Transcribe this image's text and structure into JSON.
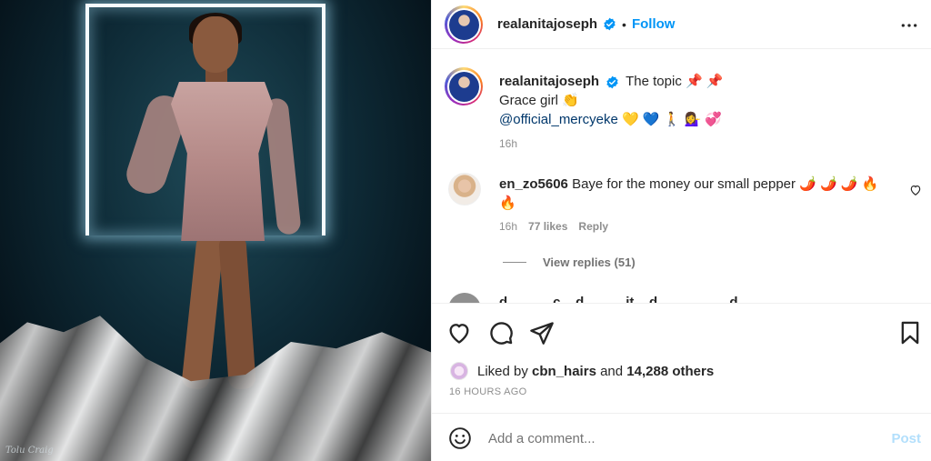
{
  "post": {
    "author": "realanitajoseph",
    "follow_label": "Follow",
    "separator": "•",
    "more_icon": "more-horizontal-icon",
    "photo_signature": "Tolu Craig"
  },
  "caption": {
    "username": "realanitajoseph",
    "line1": "The topic 📌 📌",
    "line2": "Grace girl 👏",
    "mention": "@official_mercyeke",
    "mention_emojis": "💛 💙 🚶 💁‍♀️ 💞",
    "time": "16h"
  },
  "comments": [
    {
      "username": "en_zo5606",
      "text": "Baye for the money our small pepper 🌶️ 🌶️ 🌶️ 🔥",
      "text_cont": "🔥",
      "time": "16h",
      "likes": "77 likes",
      "reply_label": "Reply",
      "view_replies": "View replies (51)"
    },
    {
      "partial_text": "d... ... ... c... d... ... ...it... d... ... ... ... ...d... ... ..."
    }
  ],
  "actions": {
    "like_icon": "heart-icon",
    "comment_icon": "comment-icon",
    "share_icon": "send-icon",
    "save_icon": "bookmark-icon"
  },
  "likes": {
    "prefix": "Liked by",
    "user": "cbn_hairs",
    "middle": "and",
    "count": "14,288 others"
  },
  "timestamp": "16 HOURS AGO",
  "add_comment": {
    "placeholder": "Add a comment...",
    "post_label": "Post"
  },
  "colors": {
    "accent_blue": "#0095f6",
    "mention_blue": "#00376b",
    "muted": "#8e8e8e"
  }
}
